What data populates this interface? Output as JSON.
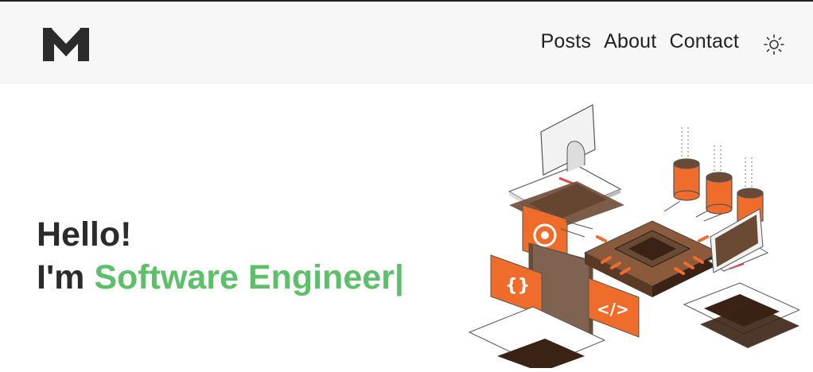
{
  "header": {
    "logo_text": "M",
    "nav": [
      "Posts",
      "About",
      "Contact"
    ],
    "theme_toggle_icon": "sun-icon"
  },
  "hero": {
    "greeting": "Hello!",
    "prefix": "I'm ",
    "role": "Software Engineer",
    "cursor": "|"
  },
  "illustration": {
    "icons": [
      "gear-icon",
      "braces-icon",
      "code-tag-icon",
      "monitor-icon",
      "cpu-chip-icon",
      "database-icon"
    ],
    "labels": [
      "{}",
      "</>"
    ]
  },
  "colors": {
    "accent": "#5cc069",
    "orange": "#ef6c2a",
    "brown": "#6b4a34",
    "dark_brown": "#3a2214",
    "text": "#2b2b2b",
    "header_bg": "#f7f7f7"
  }
}
